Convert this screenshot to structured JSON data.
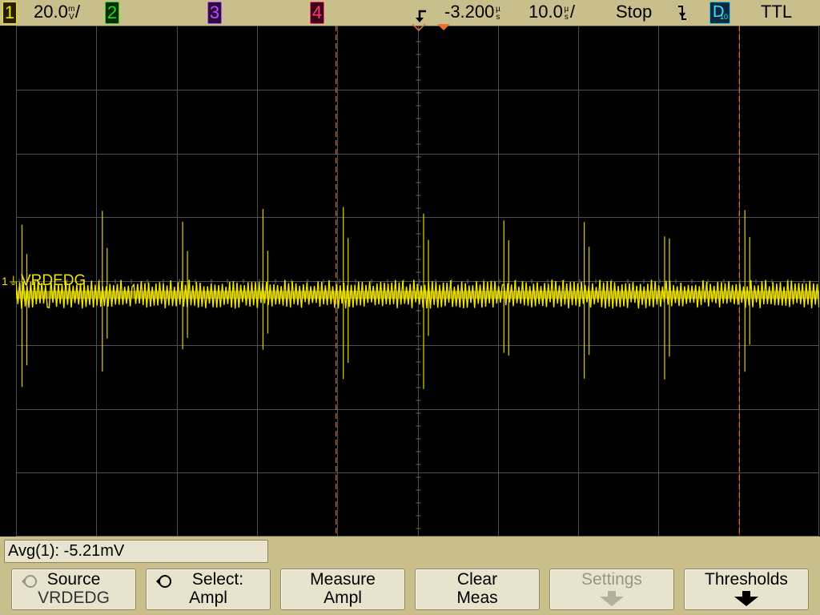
{
  "topbar": {
    "channels": [
      {
        "label": "1",
        "color": "#f2e600",
        "bg": "#222000"
      },
      {
        "label": "2",
        "color": "#28d81a",
        "bg": "#072d05"
      },
      {
        "label": "3",
        "color": "#bb4cff",
        "bg": "#2c0f3c"
      },
      {
        "label": "4",
        "color": "#ff3a7a",
        "bg": "#3c0518"
      }
    ],
    "ch1_scale": "20.0",
    "ch1_scale_unit_top": "m",
    "ch1_scale_unit_bottom": "V",
    "trigger_delay": "-3.200",
    "delay_unit_top": "µ",
    "delay_unit_bottom": "s",
    "timebase": "10.0",
    "timebase_unit_top": "µ",
    "timebase_unit_bottom": "s",
    "run_state": "Stop",
    "trigger_edge_icon": "falling-edge-icon",
    "digital_label": "D",
    "digital_sub": "10",
    "threshold": "TTL"
  },
  "waveform": {
    "channel_marker": "1",
    "channel_label": "VRDEDG",
    "trace_color": "#f2e600",
    "cursor_color": "#e8722a",
    "grid_color": "#505050"
  },
  "measurement": {
    "readout": "Avg(1): -5.21mV"
  },
  "softkeys": [
    {
      "line1": "Source",
      "line2": "VRDEDG",
      "icon": "rotate-knob-icon",
      "enabled": true
    },
    {
      "line1": "Select:",
      "line2": "Ampl",
      "icon": "rotate-knob-icon",
      "enabled": true
    },
    {
      "line1": "Measure",
      "line2": "Ampl",
      "icon": "",
      "enabled": true
    },
    {
      "line1": "Clear",
      "line2": "Meas",
      "icon": "",
      "enabled": true
    },
    {
      "line1": "Settings",
      "line2": "",
      "icon": "arrow-down-icon",
      "enabled": false
    },
    {
      "line1": "Thresholds",
      "line2": "",
      "icon": "arrow-down-icon",
      "enabled": true
    }
  ]
}
